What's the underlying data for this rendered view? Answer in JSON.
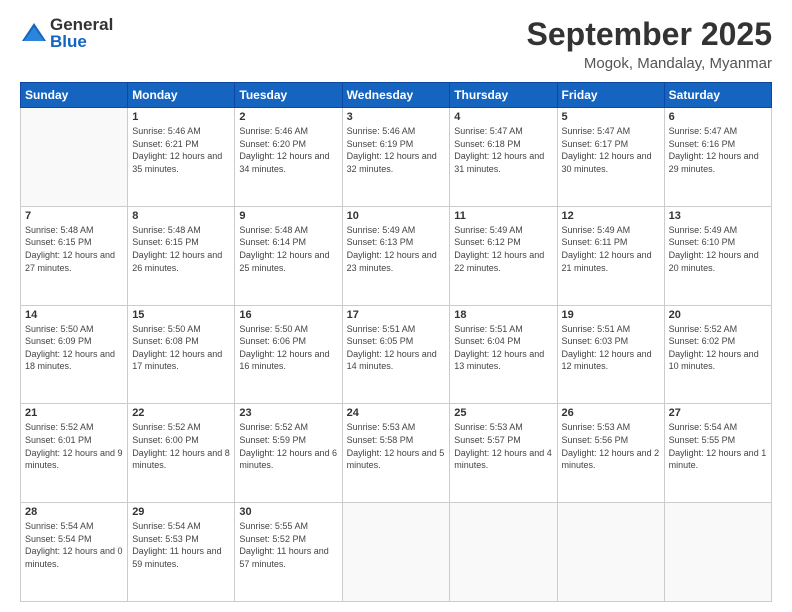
{
  "logo": {
    "general": "General",
    "blue": "Blue"
  },
  "header": {
    "month": "September 2025",
    "location": "Mogok, Mandalay, Myanmar"
  },
  "weekdays": [
    "Sunday",
    "Monday",
    "Tuesday",
    "Wednesday",
    "Thursday",
    "Friday",
    "Saturday"
  ],
  "weeks": [
    [
      {
        "day": "",
        "sunrise": "",
        "sunset": "",
        "daylight": ""
      },
      {
        "day": "1",
        "sunrise": "Sunrise: 5:46 AM",
        "sunset": "Sunset: 6:21 PM",
        "daylight": "Daylight: 12 hours and 35 minutes."
      },
      {
        "day": "2",
        "sunrise": "Sunrise: 5:46 AM",
        "sunset": "Sunset: 6:20 PM",
        "daylight": "Daylight: 12 hours and 34 minutes."
      },
      {
        "day": "3",
        "sunrise": "Sunrise: 5:46 AM",
        "sunset": "Sunset: 6:19 PM",
        "daylight": "Daylight: 12 hours and 32 minutes."
      },
      {
        "day": "4",
        "sunrise": "Sunrise: 5:47 AM",
        "sunset": "Sunset: 6:18 PM",
        "daylight": "Daylight: 12 hours and 31 minutes."
      },
      {
        "day": "5",
        "sunrise": "Sunrise: 5:47 AM",
        "sunset": "Sunset: 6:17 PM",
        "daylight": "Daylight: 12 hours and 30 minutes."
      },
      {
        "day": "6",
        "sunrise": "Sunrise: 5:47 AM",
        "sunset": "Sunset: 6:16 PM",
        "daylight": "Daylight: 12 hours and 29 minutes."
      }
    ],
    [
      {
        "day": "7",
        "sunrise": "Sunrise: 5:48 AM",
        "sunset": "Sunset: 6:15 PM",
        "daylight": "Daylight: 12 hours and 27 minutes."
      },
      {
        "day": "8",
        "sunrise": "Sunrise: 5:48 AM",
        "sunset": "Sunset: 6:15 PM",
        "daylight": "Daylight: 12 hours and 26 minutes."
      },
      {
        "day": "9",
        "sunrise": "Sunrise: 5:48 AM",
        "sunset": "Sunset: 6:14 PM",
        "daylight": "Daylight: 12 hours and 25 minutes."
      },
      {
        "day": "10",
        "sunrise": "Sunrise: 5:49 AM",
        "sunset": "Sunset: 6:13 PM",
        "daylight": "Daylight: 12 hours and 23 minutes."
      },
      {
        "day": "11",
        "sunrise": "Sunrise: 5:49 AM",
        "sunset": "Sunset: 6:12 PM",
        "daylight": "Daylight: 12 hours and 22 minutes."
      },
      {
        "day": "12",
        "sunrise": "Sunrise: 5:49 AM",
        "sunset": "Sunset: 6:11 PM",
        "daylight": "Daylight: 12 hours and 21 minutes."
      },
      {
        "day": "13",
        "sunrise": "Sunrise: 5:49 AM",
        "sunset": "Sunset: 6:10 PM",
        "daylight": "Daylight: 12 hours and 20 minutes."
      }
    ],
    [
      {
        "day": "14",
        "sunrise": "Sunrise: 5:50 AM",
        "sunset": "Sunset: 6:09 PM",
        "daylight": "Daylight: 12 hours and 18 minutes."
      },
      {
        "day": "15",
        "sunrise": "Sunrise: 5:50 AM",
        "sunset": "Sunset: 6:08 PM",
        "daylight": "Daylight: 12 hours and 17 minutes."
      },
      {
        "day": "16",
        "sunrise": "Sunrise: 5:50 AM",
        "sunset": "Sunset: 6:06 PM",
        "daylight": "Daylight: 12 hours and 16 minutes."
      },
      {
        "day": "17",
        "sunrise": "Sunrise: 5:51 AM",
        "sunset": "Sunset: 6:05 PM",
        "daylight": "Daylight: 12 hours and 14 minutes."
      },
      {
        "day": "18",
        "sunrise": "Sunrise: 5:51 AM",
        "sunset": "Sunset: 6:04 PM",
        "daylight": "Daylight: 12 hours and 13 minutes."
      },
      {
        "day": "19",
        "sunrise": "Sunrise: 5:51 AM",
        "sunset": "Sunset: 6:03 PM",
        "daylight": "Daylight: 12 hours and 12 minutes."
      },
      {
        "day": "20",
        "sunrise": "Sunrise: 5:52 AM",
        "sunset": "Sunset: 6:02 PM",
        "daylight": "Daylight: 12 hours and 10 minutes."
      }
    ],
    [
      {
        "day": "21",
        "sunrise": "Sunrise: 5:52 AM",
        "sunset": "Sunset: 6:01 PM",
        "daylight": "Daylight: 12 hours and 9 minutes."
      },
      {
        "day": "22",
        "sunrise": "Sunrise: 5:52 AM",
        "sunset": "Sunset: 6:00 PM",
        "daylight": "Daylight: 12 hours and 8 minutes."
      },
      {
        "day": "23",
        "sunrise": "Sunrise: 5:52 AM",
        "sunset": "Sunset: 5:59 PM",
        "daylight": "Daylight: 12 hours and 6 minutes."
      },
      {
        "day": "24",
        "sunrise": "Sunrise: 5:53 AM",
        "sunset": "Sunset: 5:58 PM",
        "daylight": "Daylight: 12 hours and 5 minutes."
      },
      {
        "day": "25",
        "sunrise": "Sunrise: 5:53 AM",
        "sunset": "Sunset: 5:57 PM",
        "daylight": "Daylight: 12 hours and 4 minutes."
      },
      {
        "day": "26",
        "sunrise": "Sunrise: 5:53 AM",
        "sunset": "Sunset: 5:56 PM",
        "daylight": "Daylight: 12 hours and 2 minutes."
      },
      {
        "day": "27",
        "sunrise": "Sunrise: 5:54 AM",
        "sunset": "Sunset: 5:55 PM",
        "daylight": "Daylight: 12 hours and 1 minute."
      }
    ],
    [
      {
        "day": "28",
        "sunrise": "Sunrise: 5:54 AM",
        "sunset": "Sunset: 5:54 PM",
        "daylight": "Daylight: 12 hours and 0 minutes."
      },
      {
        "day": "29",
        "sunrise": "Sunrise: 5:54 AM",
        "sunset": "Sunset: 5:53 PM",
        "daylight": "Daylight: 11 hours and 59 minutes."
      },
      {
        "day": "30",
        "sunrise": "Sunrise: 5:55 AM",
        "sunset": "Sunset: 5:52 PM",
        "daylight": "Daylight: 11 hours and 57 minutes."
      },
      {
        "day": "",
        "sunrise": "",
        "sunset": "",
        "daylight": ""
      },
      {
        "day": "",
        "sunrise": "",
        "sunset": "",
        "daylight": ""
      },
      {
        "day": "",
        "sunrise": "",
        "sunset": "",
        "daylight": ""
      },
      {
        "day": "",
        "sunrise": "",
        "sunset": "",
        "daylight": ""
      }
    ]
  ]
}
